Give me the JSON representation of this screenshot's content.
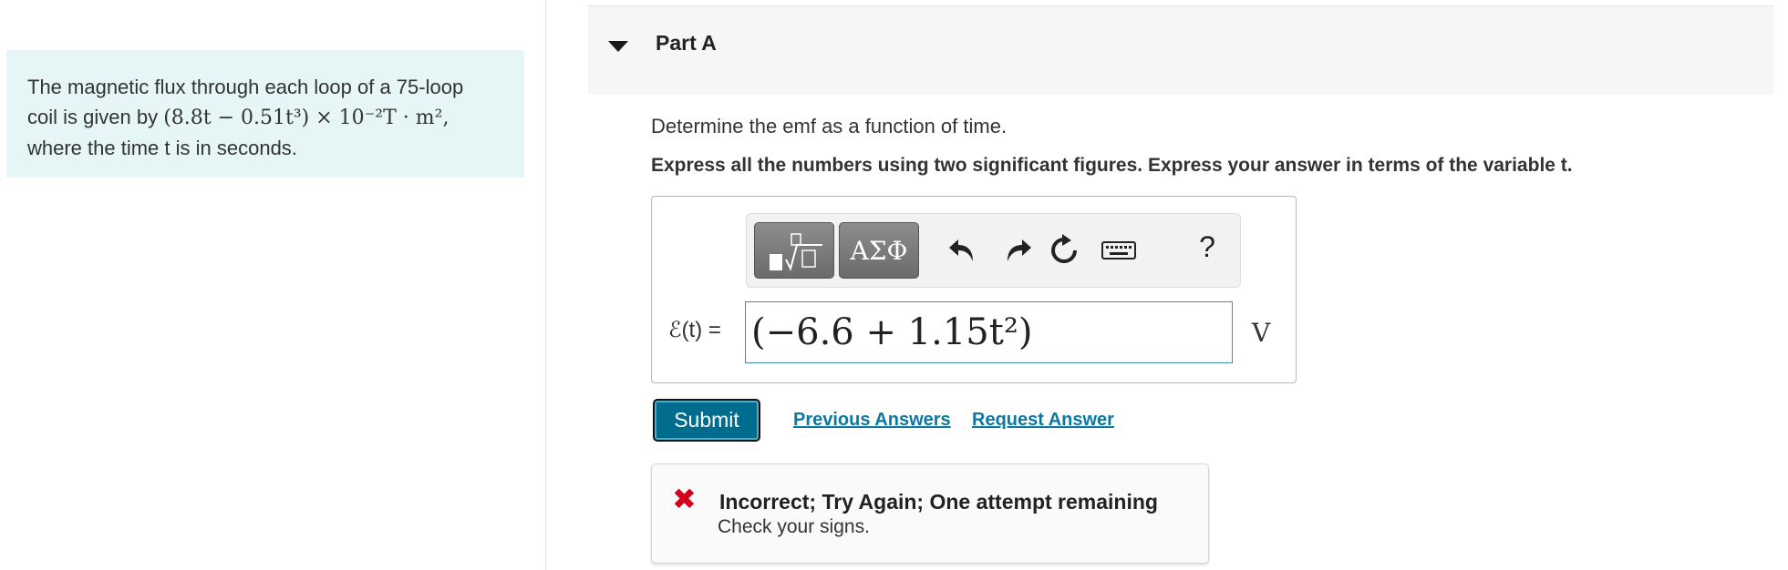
{
  "problem": {
    "line1": "The magnetic flux through each loop of a 75-loop",
    "line2_prefix": "coil is given by",
    "formula": "(8.8t − 0.51t³) × 10⁻²T · m²,",
    "line3": "where the time t is in seconds."
  },
  "part": {
    "title": "Part A"
  },
  "question": "Determine the emf as a function of time.",
  "instruction": "Express all the numbers using two significant figures. Express your answer in terms of the variable t.",
  "toolbar": {
    "greek_label": "ΑΣΦ",
    "help_label": "?"
  },
  "answer": {
    "label": "ℰ(t) =",
    "value": "(−6.6 + 1.15t²)",
    "unit": "V"
  },
  "actions": {
    "submit_label": "Submit",
    "previous_answers_label": "Previous Answers",
    "request_answer_label": "Request Answer"
  },
  "feedback": {
    "title": "Incorrect; Try Again; One attempt remaining",
    "message": "Check your signs."
  },
  "colors": {
    "accent": "#006d8f",
    "error": "#d4001c",
    "problem_bg": "#e6f5f5"
  }
}
